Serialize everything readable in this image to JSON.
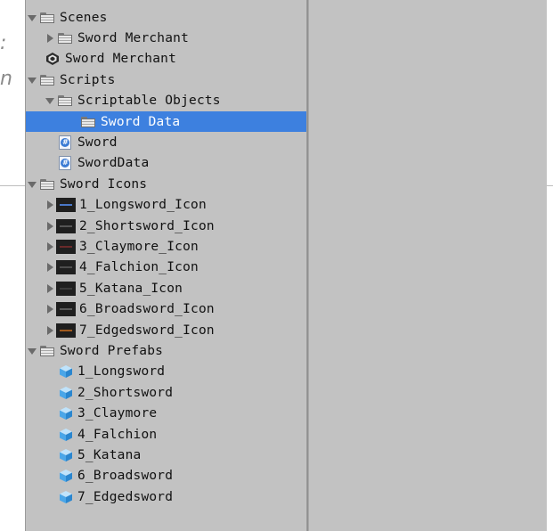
{
  "colors": {
    "panel_bg": "#c2c2c2",
    "selection": "#3d80df",
    "text": "#111111",
    "selected_text": "#ffffff",
    "script_badge": "#3b7bd4",
    "prefab_cube": "#4aa6e8"
  },
  "background_text": {
    "colon": ":",
    "letter": "n"
  },
  "project_tree": {
    "rows": [
      {
        "label": "Scenes",
        "level": 0,
        "arrow": "expanded",
        "icon": "folder-icon",
        "selected": false
      },
      {
        "label": "Sword Merchant",
        "level": 1,
        "arrow": "collapsed",
        "icon": "folder-icon",
        "selected": false
      },
      {
        "label": "Sword Merchant",
        "level": 1,
        "arrow": "none",
        "icon": "unity-scene-icon",
        "selected": false
      },
      {
        "label": "Scripts",
        "level": 0,
        "arrow": "expanded",
        "icon": "folder-icon",
        "selected": false
      },
      {
        "label": "Scriptable Objects",
        "level": 1,
        "arrow": "expanded",
        "icon": "folder-icon",
        "selected": false
      },
      {
        "label": "Sword Data",
        "level": 3,
        "arrow": "none",
        "icon": "folder-icon",
        "selected": true
      },
      {
        "label": "Sword",
        "level": 2,
        "arrow": "none",
        "icon": "csharp-script-icon",
        "selected": false
      },
      {
        "label": "SwordData",
        "level": 2,
        "arrow": "none",
        "icon": "csharp-script-icon",
        "selected": false
      },
      {
        "label": "Sword Icons",
        "level": 0,
        "arrow": "expanded",
        "icon": "folder-icon",
        "selected": false
      },
      {
        "label": "1_Longsword_Icon",
        "level": 1,
        "arrow": "collapsed",
        "icon": "sprite-thumbnail-icon",
        "streak": "#4a78c8",
        "selected": false
      },
      {
        "label": "2_Shortsword_Icon",
        "level": 1,
        "arrow": "collapsed",
        "icon": "sprite-thumbnail-icon",
        "streak": "#555555",
        "selected": false
      },
      {
        "label": "3_Claymore_Icon",
        "level": 1,
        "arrow": "collapsed",
        "icon": "sprite-thumbnail-icon",
        "streak": "#6a2a2a",
        "selected": false
      },
      {
        "label": "4_Falchion_Icon",
        "level": 1,
        "arrow": "collapsed",
        "icon": "sprite-thumbnail-icon",
        "streak": "#4d4d4d",
        "selected": false
      },
      {
        "label": "5_Katana_Icon",
        "level": 1,
        "arrow": "collapsed",
        "icon": "sprite-thumbnail-icon",
        "streak": "#3a3a3a",
        "selected": false
      },
      {
        "label": "6_Broadsword_Icon",
        "level": 1,
        "arrow": "collapsed",
        "icon": "sprite-thumbnail-icon",
        "streak": "#5a5a5a",
        "selected": false
      },
      {
        "label": "7_Edgedsword_Icon",
        "level": 1,
        "arrow": "collapsed",
        "icon": "sprite-thumbnail-icon",
        "streak": "#a05a1e",
        "selected": false
      },
      {
        "label": "Sword Prefabs",
        "level": 0,
        "arrow": "expanded",
        "icon": "folder-icon",
        "selected": false
      },
      {
        "label": "1_Longsword",
        "level": 2,
        "arrow": "none",
        "icon": "prefab-cube-icon",
        "selected": false
      },
      {
        "label": "2_Shortsword",
        "level": 2,
        "arrow": "none",
        "icon": "prefab-cube-icon",
        "selected": false
      },
      {
        "label": "3_Claymore",
        "level": 2,
        "arrow": "none",
        "icon": "prefab-cube-icon",
        "selected": false
      },
      {
        "label": "4_Falchion",
        "level": 2,
        "arrow": "none",
        "icon": "prefab-cube-icon",
        "selected": false
      },
      {
        "label": "5_Katana",
        "level": 2,
        "arrow": "none",
        "icon": "prefab-cube-icon",
        "selected": false
      },
      {
        "label": "6_Broadsword",
        "level": 2,
        "arrow": "none",
        "icon": "prefab-cube-icon",
        "selected": false
      },
      {
        "label": "7_Edgedsword",
        "level": 2,
        "arrow": "none",
        "icon": "prefab-cube-icon",
        "selected": false
      }
    ]
  }
}
